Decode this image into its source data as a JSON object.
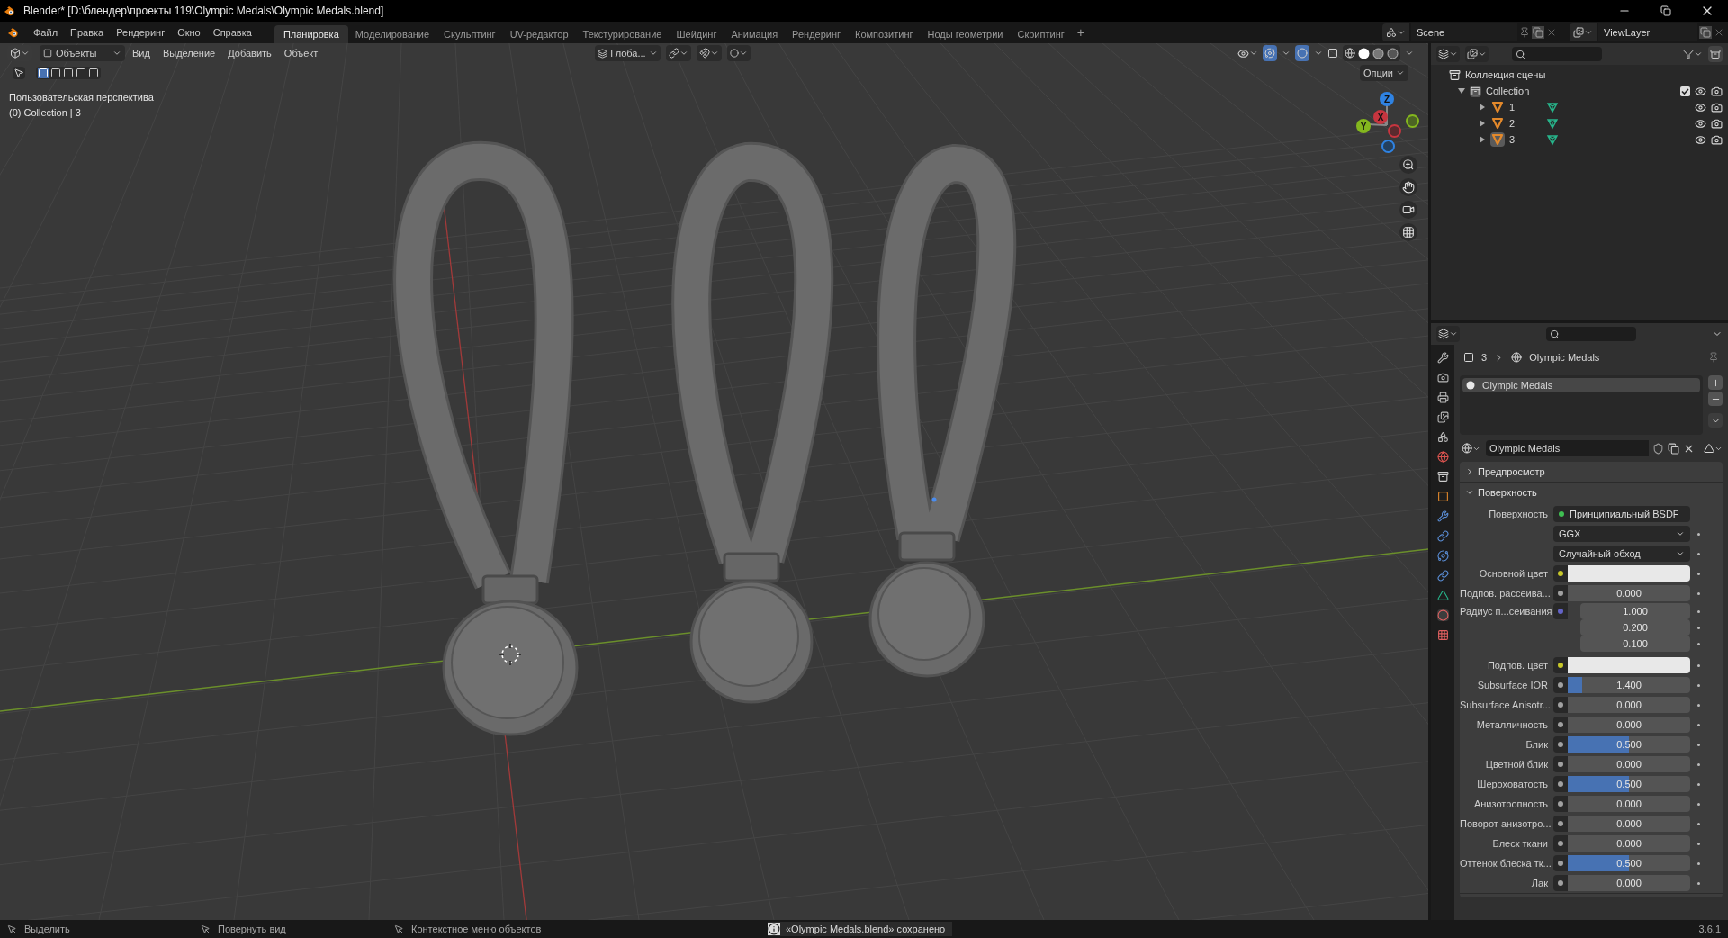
{
  "window": {
    "title": "Blender* [D:\\блендер\\проекты 119\\Olympic Medals\\Olympic Medals.blend]"
  },
  "menu": [
    "Файл",
    "Правка",
    "Рендеринг",
    "Окно",
    "Справка"
  ],
  "workspaces": [
    {
      "label": "Планировка",
      "selected": true
    },
    {
      "label": "Моделирование",
      "selected": false
    },
    {
      "label": "Скульптинг",
      "selected": false
    },
    {
      "label": "UV-редактор",
      "selected": false
    },
    {
      "label": "Текстурирование",
      "selected": false
    },
    {
      "label": "Шейдинг",
      "selected": false
    },
    {
      "label": "Анимация",
      "selected": false
    },
    {
      "label": "Рендеринг",
      "selected": false
    },
    {
      "label": "Композитинг",
      "selected": false
    },
    {
      "label": "Ноды геометрии",
      "selected": false
    },
    {
      "label": "Скриптинг",
      "selected": false
    }
  ],
  "add_workspace": "+",
  "scene": {
    "scene_name": "Scene",
    "view_layer": "ViewLayer"
  },
  "viewport": {
    "mode": "Объекты",
    "menus": [
      "Вид",
      "Выделение",
      "Добавить",
      "Объект"
    ],
    "transform_orientation": "Глоба...",
    "options_button": "Опции",
    "view_name": "Пользовательская перспектива",
    "collection_info": "(0) Collection | 3",
    "gizmo_axes": [
      "Z",
      "X",
      "Y"
    ]
  },
  "outliner": {
    "tree": [
      {
        "label": "Коллекция сцены",
        "kind": "scene_collection",
        "children": [
          {
            "label": "Collection",
            "kind": "collection",
            "expanded": true,
            "checked": true,
            "children": [
              {
                "label": "1",
                "kind": "object",
                "expanded": false,
                "selected": false
              },
              {
                "label": "2",
                "kind": "object",
                "expanded": false,
                "selected": false
              },
              {
                "label": "3",
                "kind": "object",
                "expanded": false,
                "selected": true
              }
            ]
          }
        ]
      }
    ]
  },
  "properties": {
    "breadcrumb": {
      "object": "3",
      "material": "Olympic Medals"
    },
    "material_slots": [
      {
        "label": "Olympic Medals",
        "selected": true
      }
    ],
    "material_name": "Olympic Medals",
    "panels": [
      {
        "label": "Предпросмотр",
        "expanded": false
      },
      {
        "label": "Поверхность",
        "expanded": true,
        "rows": [
          {
            "kind": "shader",
            "label": "Поверхность",
            "value": "Принципиальный BSDF",
            "color": "#3fbf52"
          },
          {
            "kind": "dropdown",
            "value": "GGX"
          },
          {
            "kind": "dropdown",
            "value": "Случайный обход"
          },
          {
            "kind": "color",
            "label": "Основной цвет",
            "color": "#c7c729"
          },
          {
            "kind": "number",
            "label": "Подпов. рассеива...",
            "value": "0.000",
            "color": "#a1a1a1"
          },
          {
            "kind": "vector",
            "label": "Радиус п...сеивания",
            "values": [
              "1.000",
              "0.200",
              "0.100"
            ],
            "color": "#6363c7"
          },
          {
            "kind": "color",
            "label": "Подпов. цвет",
            "color": "#c7c729"
          },
          {
            "kind": "number",
            "label": "Subsurface IOR",
            "value": "1.400",
            "level": 0.12,
            "color": "#a1a1a1"
          },
          {
            "kind": "number",
            "label": "Subsurface Anisotr...",
            "value": "0.000",
            "color": "#a1a1a1"
          },
          {
            "kind": "number",
            "label": "Металличность",
            "value": "0.000",
            "color": "#a1a1a1"
          },
          {
            "kind": "number",
            "label": "Блик",
            "value": "0.500",
            "level": 0.5,
            "color": "#a1a1a1"
          },
          {
            "kind": "number",
            "label": "Цветной блик",
            "value": "0.000",
            "color": "#a1a1a1"
          },
          {
            "kind": "number",
            "label": "Шероховатость",
            "value": "0.500",
            "level": 0.5,
            "color": "#a1a1a1"
          },
          {
            "kind": "number",
            "label": "Анизотропность",
            "value": "0.000",
            "color": "#a1a1a1"
          },
          {
            "kind": "number",
            "label": "Поворот анизотро...",
            "value": "0.000",
            "color": "#a1a1a1"
          },
          {
            "kind": "number",
            "label": "Блеск ткани",
            "value": "0.000",
            "color": "#a1a1a1"
          },
          {
            "kind": "number",
            "label": "Оттенок блеска тк...",
            "value": "0.500",
            "level": 0.5,
            "color": "#a1a1a1"
          },
          {
            "kind": "number",
            "label": "Лак",
            "value": "0.000",
            "color": "#a1a1a1"
          }
        ]
      }
    ]
  },
  "status_bar": {
    "hints": [
      "Выделить",
      "Повернуть вид",
      "Контекстное меню объектов"
    ],
    "report": "«Olympic Medals.blend» сохранено",
    "version": "3.6.1"
  }
}
